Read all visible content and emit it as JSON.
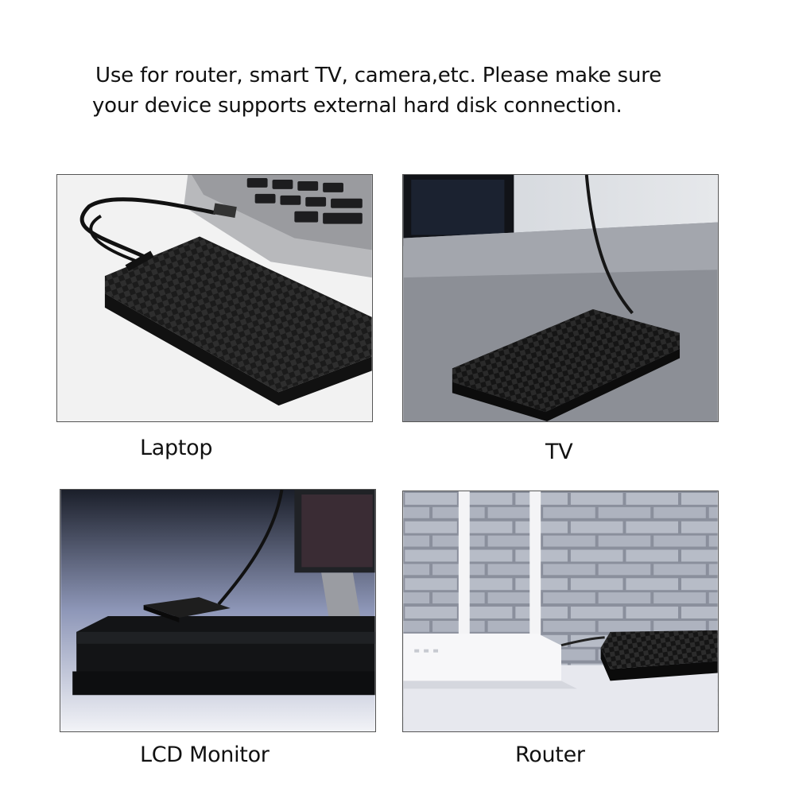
{
  "headline": {
    "line1": "Use for router, smart TV, camera,etc. Please make sure",
    "line2": "your device supports external hard disk connection."
  },
  "panels": [
    {
      "caption": "Laptop"
    },
    {
      "caption": "TV"
    },
    {
      "caption": "LCD Monitor"
    },
    {
      "caption": "Router"
    }
  ],
  "colors": {
    "background": "#ffffff",
    "text": "#111111",
    "drive": "#1a1a1a"
  }
}
